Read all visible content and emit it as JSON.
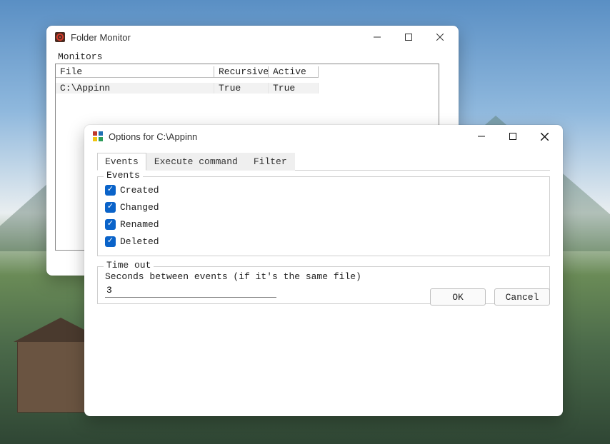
{
  "main_window": {
    "title": "Folder Monitor",
    "section_label": "Monitors",
    "columns": {
      "file": "File",
      "recursive": "Recursive",
      "active": "Active"
    },
    "rows": [
      {
        "file": "C:\\Appinn",
        "recursive": "True",
        "active": "True"
      }
    ]
  },
  "options_window": {
    "title": "Options for C:\\Appinn",
    "tabs": {
      "events": "Events",
      "execute": "Execute command",
      "filter": "Filter"
    },
    "events_group": {
      "legend": "Events",
      "items": {
        "created": "Created",
        "changed": "Changed",
        "renamed": "Renamed",
        "deleted": "Deleted"
      }
    },
    "timeout_group": {
      "legend": "Time out",
      "hint": "Seconds between events (if it's the same file)",
      "value": "3"
    },
    "buttons": {
      "ok": "OK",
      "cancel": "Cancel"
    }
  }
}
